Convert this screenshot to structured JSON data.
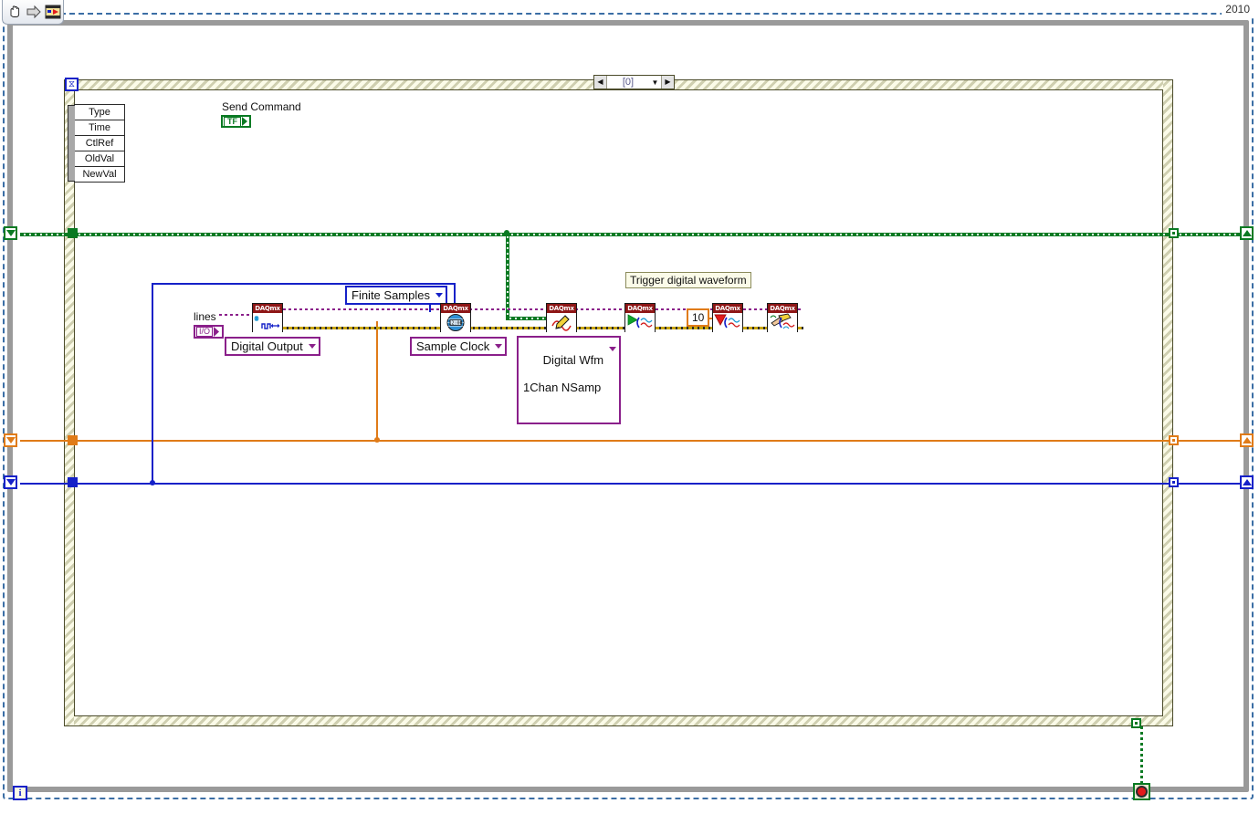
{
  "window": {
    "version_label": "2010"
  },
  "toolbar": {
    "items": [
      {
        "name": "pan-hand-icon",
        "label": "Pan"
      },
      {
        "name": "arrow-right-icon",
        "label": "Next"
      },
      {
        "name": "vi-icon",
        "label": "VI"
      }
    ]
  },
  "diagram": {
    "case_selector": {
      "left_arrow": "◀",
      "case_value": "[0]",
      "dropdown_caret": "▼",
      "right_arrow": "▶"
    },
    "timeout_terminal": {
      "glyph": "⧖"
    },
    "event_data_node": {
      "rows": [
        "Type",
        "Time",
        "CtlRef",
        "OldVal",
        "NewVal"
      ]
    },
    "labels": {
      "send_command": "Send Command",
      "lines": "lines",
      "trigger_digital_waveform": "Trigger digital waveform"
    },
    "constants": {
      "send_command_bool": "TF",
      "lines_io": "I/O",
      "wait_timeout": "10"
    },
    "rings": [
      {
        "name": "physical-channel-type-ring",
        "text": "Digital Output"
      },
      {
        "name": "sample-mode-ring",
        "text": "Finite Samples"
      },
      {
        "name": "timing-type-ring",
        "text": "Sample Clock"
      },
      {
        "name": "write-polymorphic-ring",
        "line1": "Digital Wfm",
        "line2": "1Chan NSamp"
      }
    ],
    "daqmx_nodes": [
      {
        "name": "daqmx-create-channel",
        "header": "DAQmx",
        "function": "Create Virtual Channel"
      },
      {
        "name": "daqmx-timing",
        "header": "DAQmx",
        "function": "Timing"
      },
      {
        "name": "daqmx-write",
        "header": "DAQmx",
        "function": "Write"
      },
      {
        "name": "daqmx-start-task",
        "header": "DAQmx",
        "function": "Start Task"
      },
      {
        "name": "daqmx-wait-until-done",
        "header": "DAQmx",
        "function": "Wait Until Done"
      },
      {
        "name": "daqmx-clear-task",
        "header": "DAQmx",
        "function": "Clear Task"
      }
    ],
    "iteration_terminal": {
      "label": "i"
    },
    "stop_terminal": {
      "label": "stop"
    }
  },
  "colors": {
    "daqmx_header": "#8e1616",
    "boolean_green": "#0a7a23",
    "io_violet": "#8a1f8a",
    "numeric_orange": "#e07b18",
    "integer_blue": "#1521c8",
    "error_yellow": "#c8a400",
    "structure_border": "#4b4b2a"
  }
}
